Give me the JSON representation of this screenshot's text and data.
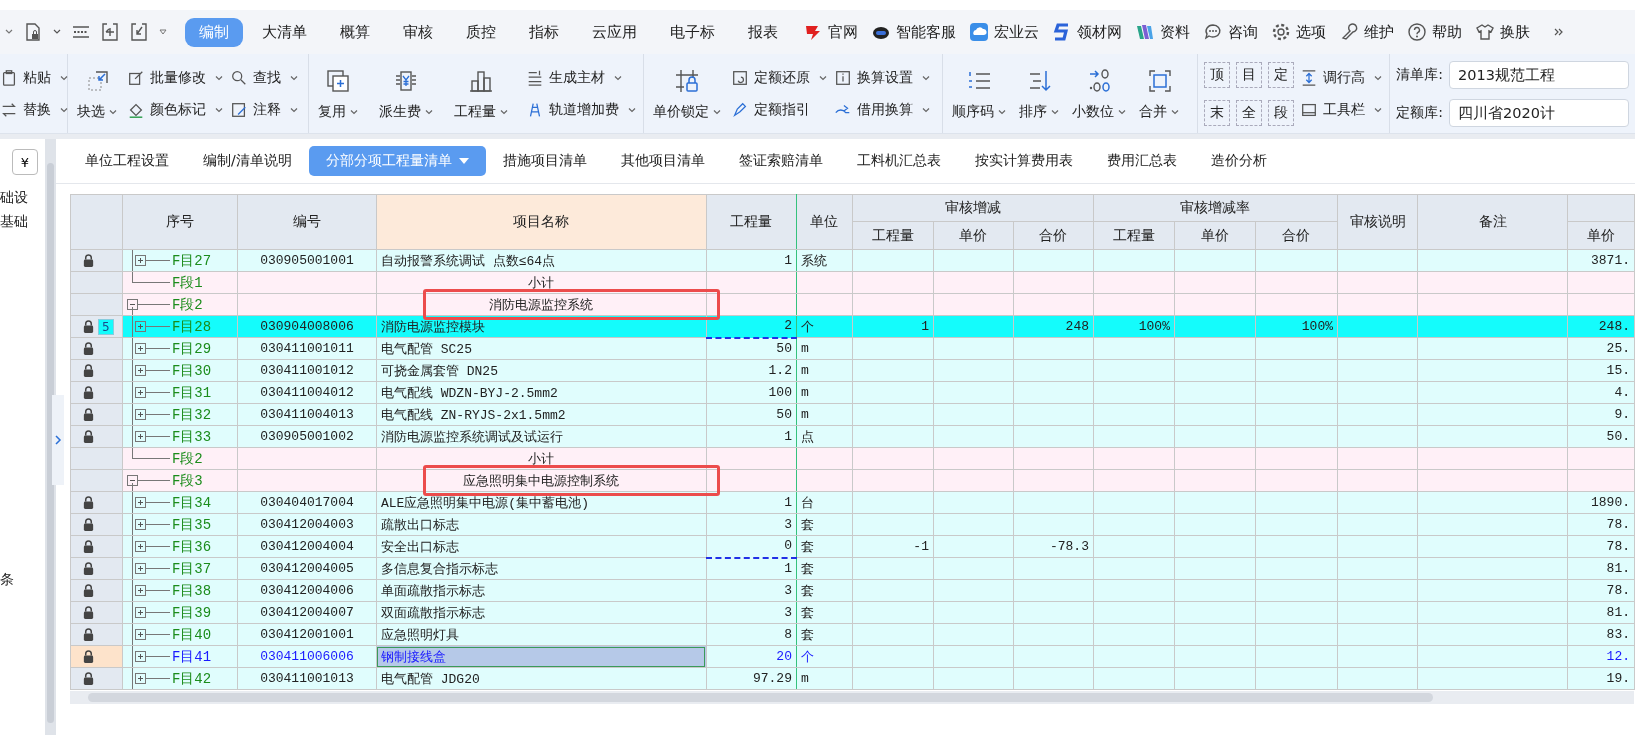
{
  "menu_tabs": [
    {
      "label": "编制",
      "selected": true
    },
    {
      "label": "大清单",
      "selected": false
    },
    {
      "label": "概算",
      "selected": false
    },
    {
      "label": "审核",
      "selected": false
    },
    {
      "label": "质控",
      "selected": false
    },
    {
      "label": "指标",
      "selected": false
    },
    {
      "label": "云应用",
      "selected": false
    },
    {
      "label": "电子标",
      "selected": false
    },
    {
      "label": "报表",
      "selected": false
    }
  ],
  "top_links": [
    "官网",
    "智能客服",
    "宏业云",
    "领材网",
    "资料",
    "咨询",
    "选项",
    "维护",
    "帮助",
    "换肤"
  ],
  "ribbon": [
    {
      "columns": [
        {
          "kind": "stack",
          "items": [
            {
              "label": "粘贴",
              "dropdown": true
            },
            {
              "label": "替换",
              "dropdown": true
            }
          ]
        }
      ]
    },
    {
      "columns": [
        {
          "kind": "large",
          "label": "块选",
          "dropdown": true
        },
        {
          "kind": "stack",
          "items": [
            {
              "label": "批量修改",
              "dropdown": true
            },
            {
              "label": "颜色标记",
              "dropdown": true
            }
          ]
        },
        {
          "kind": "stack",
          "items": [
            {
              "label": "查找",
              "dropdown": true
            },
            {
              "label": "注释",
              "dropdown": true
            }
          ]
        }
      ]
    },
    {
      "columns": [
        {
          "kind": "large",
          "label": "复用",
          "dropdown": true
        },
        {
          "kind": "large",
          "label": "派生费",
          "dropdown": true
        },
        {
          "kind": "large",
          "label": "工程量",
          "dropdown": true
        },
        {
          "kind": "stack",
          "items": [
            {
              "label": "生成主材",
              "dropdown": true
            },
            {
              "label": "轨道增加费",
              "dropdown": true
            }
          ]
        }
      ]
    },
    {
      "columns": [
        {
          "kind": "large",
          "label": "单价锁定",
          "dropdown": true
        },
        {
          "kind": "stack",
          "items": [
            {
              "label": "定额还原",
              "dropdown": true
            },
            {
              "label": "定额指引",
              "dropdown": false
            }
          ]
        },
        {
          "kind": "stack",
          "items": [
            {
              "label": "换算设置",
              "dropdown": true
            },
            {
              "label": "借用换算",
              "dropdown": true
            }
          ]
        }
      ]
    },
    {
      "columns": [
        {
          "kind": "large",
          "label": "顺序码",
          "dropdown": true
        },
        {
          "kind": "large",
          "label": "排序",
          "dropdown": true
        },
        {
          "kind": "large",
          "label": "小数位",
          "dropdown": true
        },
        {
          "kind": "large",
          "label": "合并",
          "dropdown": true
        }
      ]
    },
    {
      "columns": [
        {
          "kind": "chars",
          "items": [
            "顶",
            "目",
            "定",
            "末",
            "全",
            "段"
          ]
        },
        {
          "kind": "stack",
          "items": [
            {
              "label": "调行高",
              "dropdown": true
            },
            {
              "label": "工具栏",
              "dropdown": true
            }
          ]
        }
      ]
    },
    {
      "columns": [
        {
          "kind": "fields",
          "items": [
            {
              "label": "清单库:",
              "value": "2013规范工程"
            },
            {
              "label": "定额库:",
              "value": "四川省2020计"
            }
          ]
        }
      ]
    }
  ],
  "sidebar": {
    "button": "¥",
    "items": [
      "础设",
      "基础",
      "条"
    ]
  },
  "sheet_tabs": [
    {
      "label": "单位工程设置",
      "selected": false,
      "dropdown": false
    },
    {
      "label": "编制/清单说明",
      "selected": false,
      "dropdown": false
    },
    {
      "label": "分部分项工程量清单",
      "selected": true,
      "dropdown": true
    },
    {
      "label": "措施项目清单",
      "selected": false,
      "dropdown": false
    },
    {
      "label": "其他项目清单",
      "selected": false,
      "dropdown": false
    },
    {
      "label": "签证索赔清单",
      "selected": false,
      "dropdown": false
    },
    {
      "label": "工料机汇总表",
      "selected": false,
      "dropdown": false
    },
    {
      "label": "按实计算费用表",
      "selected": false,
      "dropdown": false
    },
    {
      "label": "费用汇总表",
      "selected": false,
      "dropdown": false
    },
    {
      "label": "造价分析",
      "selected": false,
      "dropdown": false
    }
  ],
  "table": {
    "columns_left": [
      "序号",
      "编号",
      "项目名称",
      "工程量",
      "单位"
    ],
    "groups": [
      {
        "label": "审核增减",
        "columns": [
          "工程量",
          "单价",
          "合价"
        ]
      },
      {
        "label": "审核增减率",
        "columns": [
          "工程量",
          "单价",
          "合价"
        ]
      }
    ],
    "columns_right": [
      "审核说明",
      "备注"
    ],
    "column_last": "单价",
    "rows": [
      {
        "kind": "item",
        "seq": "F目27",
        "code": "030905001001",
        "name": "自动报警系统调试 点数≤64点",
        "qty": "1",
        "unit": "系统",
        "d_qty": "",
        "d_total": "",
        "r_qty": "",
        "r_total": "",
        "price": "3871.",
        "locked": true,
        "expanded": false,
        "selected": false,
        "focused": false,
        "modified": false
      },
      {
        "kind": "subtotal",
        "seq": "F段1",
        "name": "小计",
        "price": "",
        "locked": false,
        "selected": false,
        "focused": false,
        "modified": false
      },
      {
        "kind": "section",
        "seq": "F段2",
        "name": "消防电源监控系统",
        "locked": false,
        "expanded": true,
        "highlighted": true,
        "selected": false,
        "focused": false,
        "modified": false,
        "children": [
          {
            "kind": "item",
            "seq": "F目28",
            "code": "030904008006",
            "name": "消防电源监控模块",
            "qty": "2",
            "unit": "个",
            "d_qty": "1",
            "d_total": "248",
            "r_qty": "100%",
            "r_total": "100%",
            "price": "248.",
            "locked": true,
            "badge": "5",
            "expanded": false,
            "selected": true,
            "focused": false,
            "modified": true
          },
          {
            "kind": "item",
            "seq": "F目29",
            "code": "030411001011",
            "name": "电气配管 SC25",
            "qty": "50",
            "unit": "m",
            "price": "25.",
            "locked": true,
            "expanded": false,
            "selected": false,
            "focused": false,
            "modified": false
          },
          {
            "kind": "item",
            "seq": "F目30",
            "code": "030411001012",
            "name": "可挠金属套管 DN25",
            "qty": "1.2",
            "unit": "m",
            "price": "15.",
            "locked": true,
            "expanded": false,
            "selected": false,
            "focused": false,
            "modified": false
          },
          {
            "kind": "item",
            "seq": "F目31",
            "code": "030411004012",
            "name": "电气配线 WDZN-BYJ-2.5mm2",
            "qty": "100",
            "unit": "m",
            "price": "4.",
            "locked": true,
            "expanded": false,
            "selected": false,
            "focused": false,
            "modified": false
          },
          {
            "kind": "item",
            "seq": "F目32",
            "code": "030411004013",
            "name": "电气配线 ZN-RYJS-2x1.5mm2",
            "qty": "50",
            "unit": "m",
            "price": "9.",
            "locked": true,
            "expanded": false,
            "selected": false,
            "focused": false,
            "modified": false
          },
          {
            "kind": "item",
            "seq": "F目33",
            "code": "030905001002",
            "name": "消防电源监控系统调试及试运行",
            "qty": "1",
            "unit": "点",
            "price": "50.",
            "locked": true,
            "expanded": false,
            "selected": false,
            "focused": false,
            "modified": false
          },
          {
            "kind": "subtotal",
            "seq": "F段2",
            "name": "小计",
            "locked": false,
            "selected": false,
            "focused": false,
            "modified": false
          }
        ]
      },
      {
        "kind": "section",
        "seq": "F段3",
        "name": "应急照明集中电源控制系统",
        "locked": false,
        "expanded": true,
        "highlighted": true,
        "selected": false,
        "focused": false,
        "modified": false,
        "children": [
          {
            "kind": "item",
            "seq": "F目34",
            "code": "030404017004",
            "name": "ALE应急照明集中电源(集中蓄电池)",
            "qty": "1",
            "unit": "台",
            "price": "1890.",
            "locked": true,
            "expanded": false,
            "selected": false,
            "focused": false,
            "modified": false
          },
          {
            "kind": "item",
            "seq": "F目35",
            "code": "030412004003",
            "name": "疏散出口标志",
            "qty": "3",
            "unit": "套",
            "price": "78.",
            "locked": true,
            "expanded": false,
            "selected": false,
            "focused": false,
            "modified": false
          },
          {
            "kind": "item",
            "seq": "F目36",
            "code": "030412004004",
            "name": "安全出口标志",
            "qty": "0",
            "unit": "套",
            "d_qty": "-1",
            "d_total": "-78.3",
            "price": "78.",
            "locked": true,
            "expanded": false,
            "selected": false,
            "focused": false,
            "modified": true
          },
          {
            "kind": "item",
            "seq": "F目37",
            "code": "030412004005",
            "name": "多信息复合指示标志",
            "qty": "1",
            "unit": "套",
            "price": "81.",
            "locked": true,
            "expanded": false,
            "selected": false,
            "focused": false,
            "modified": false
          },
          {
            "kind": "item",
            "seq": "F目38",
            "code": "030412004006",
            "name": "单面疏散指示标志",
            "qty": "3",
            "unit": "套",
            "price": "78.",
            "locked": true,
            "expanded": false,
            "selected": false,
            "focused": false,
            "modified": false
          },
          {
            "kind": "item",
            "seq": "F目39",
            "code": "030412004007",
            "name": "双面疏散指示标志",
            "qty": "3",
            "unit": "套",
            "price": "81.",
            "locked": true,
            "expanded": false,
            "selected": false,
            "focused": false,
            "modified": false
          },
          {
            "kind": "item",
            "seq": "F目40",
            "code": "030412001001",
            "name": "应急照明灯具",
            "qty": "8",
            "unit": "套",
            "price": "83.",
            "locked": true,
            "expanded": false,
            "selected": false,
            "focused": false,
            "modified": false
          },
          {
            "kind": "item",
            "seq": "F目41",
            "code": "030411006006",
            "name": "钢制接线盒",
            "qty": "20",
            "unit": "个",
            "price": "12.",
            "locked": true,
            "expanded": false,
            "selected": false,
            "focused": true,
            "modified": false
          },
          {
            "kind": "item",
            "seq": "F目42",
            "code": "030411001013",
            "name": "电气配管 JDG20",
            "qty": "97.29",
            "unit": "m",
            "price": "19.",
            "locked": true,
            "expanded": false,
            "selected": false,
            "focused": false,
            "modified": false
          }
        ]
      }
    ]
  }
}
